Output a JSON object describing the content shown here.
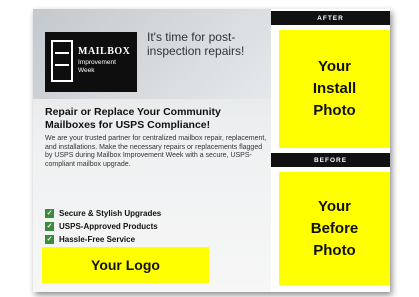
{
  "brand": {
    "name": "MAILBOX",
    "subtitle": "Improvement Week",
    "tagline": "It's time for post-inspection repairs!"
  },
  "headline": "Repair or Replace Your Community Mailboxes for USPS Compliance!",
  "body": "We are your trusted partner for centralized mailbox repair, replacement, and installations. Make the necessary repairs or replacements flagged by USPS during Mailbox Improvement Week with a secure, USPS-compliant mailbox upgrade.",
  "features": [
    "Secure & Stylish Upgrades",
    "USPS-Approved Products",
    "Hassle-Free Service"
  ],
  "your_logo": "Your Logo",
  "after": {
    "label": "AFTER",
    "placeholder": "Your\nInstall\nPhoto"
  },
  "before": {
    "label": "BEFORE",
    "placeholder": "Your\nBefore\nPhoto"
  },
  "colors": {
    "placeholder": "#ffff00",
    "band": "#111111",
    "check": "#3c8a3c"
  }
}
